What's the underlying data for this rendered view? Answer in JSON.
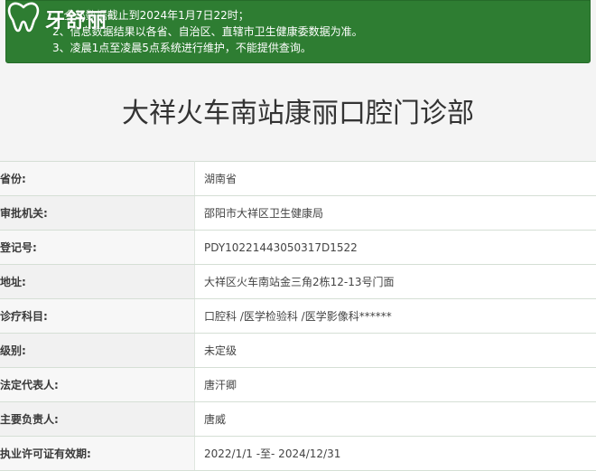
{
  "logo": {
    "text": "牙舒丽"
  },
  "notice": {
    "lines": [
      "1、全部数据截止到2024年1月7日22时；",
      "2、信息数据结果以各省、自治区、直辖市卫生健康委数据为准。",
      "3、凌晨1点至凌晨5点系统进行维护，不能提供查询。"
    ]
  },
  "clinic": {
    "name": "大祥火车南站康丽口腔门诊部"
  },
  "details": {
    "rows": [
      {
        "label": "省份:",
        "value": "湖南省"
      },
      {
        "label": "审批机关:",
        "value": "邵阳市大祥区卫生健康局"
      },
      {
        "label": "登记号:",
        "value": "PDY10221443050317D1522"
      },
      {
        "label": "地址:",
        "value": "大祥区火车南站金三角2栋12-13号门面"
      },
      {
        "label": "诊疗科目:",
        "value": "口腔科 /医学检验科 /医学影像科******"
      },
      {
        "label": "级别:",
        "value": "未定级"
      },
      {
        "label": "法定代表人:",
        "value": "唐汗卿"
      },
      {
        "label": "主要负责人:",
        "value": "唐威"
      },
      {
        "label": "执业许可证有效期:",
        "value": "2022/1/1 -至- 2024/12/31"
      }
    ]
  },
  "colors": {
    "notice_bg": "#2e7d32",
    "page_bg": "#f4f4f4"
  }
}
